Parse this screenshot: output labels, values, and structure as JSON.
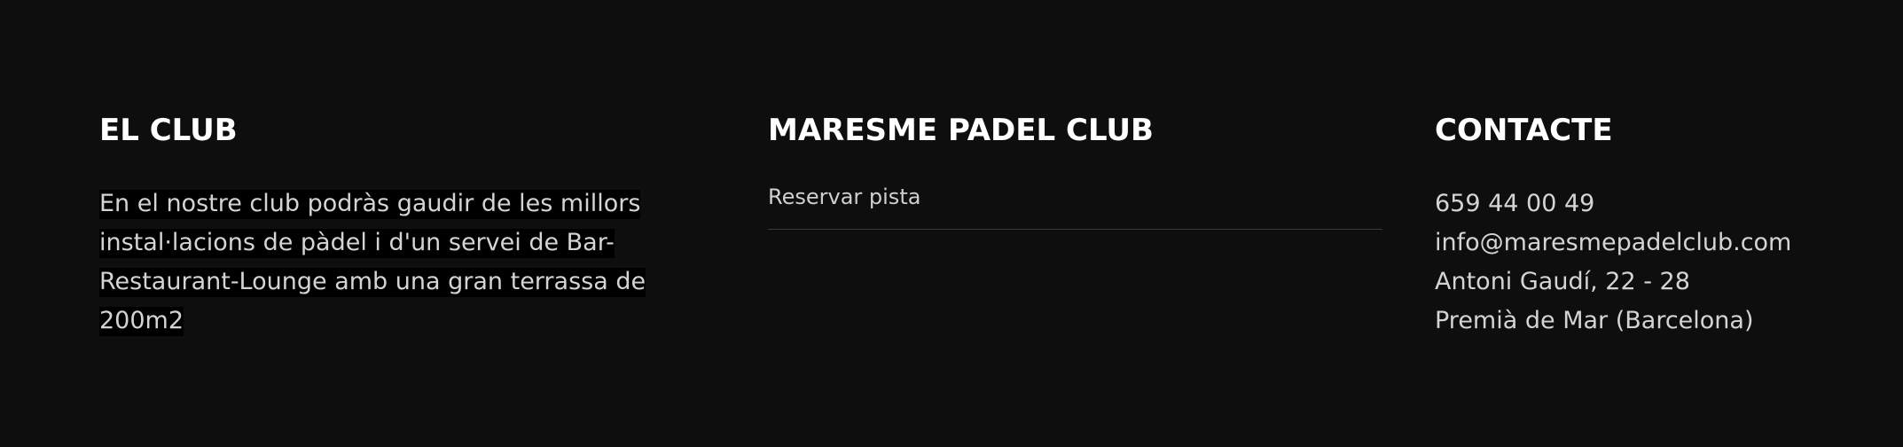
{
  "footer": {
    "club": {
      "heading": "EL CLUB",
      "lines": [
        "En el nostre club podràs gaudir de les millors",
        "instal·lacions de pàdel i d'un servei de Bar-",
        "Restaurant-Lounge amb una gran terrassa de 200m2"
      ]
    },
    "maresme": {
      "heading": "MARESME PADEL CLUB",
      "links": [
        {
          "label": "Reservar pista"
        }
      ]
    },
    "contact": {
      "heading": "CONTACTE",
      "phone": "659 44 00 49",
      "email": "info@maresmepadelclub.com",
      "address_line1": "Antoni Gaudí, 22 - 28",
      "address_line2": "Premià de Mar (Barcelona)"
    },
    "colors": {
      "background": "#0e0e0e",
      "heading": "#ffffff",
      "text": "#d4d4d4",
      "divider": "#3b3b3b",
      "text_highlight": "#000000"
    }
  }
}
